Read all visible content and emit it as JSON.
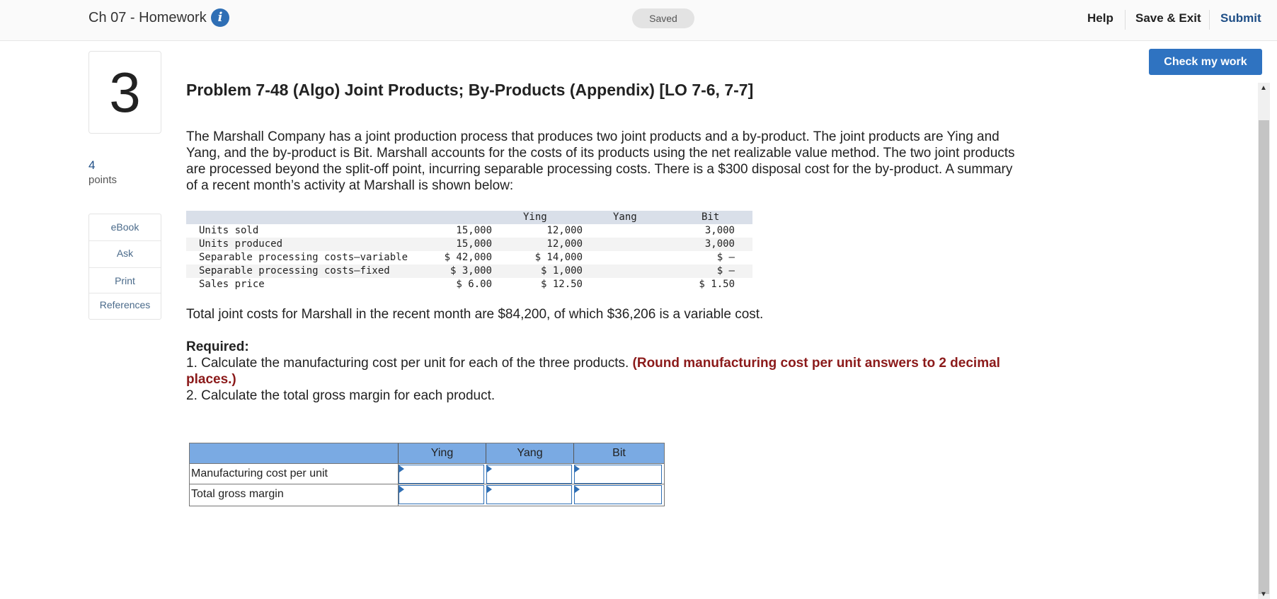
{
  "header": {
    "assignment_title": "Ch 07 - Homework",
    "info_icon": "i",
    "saved_label": "Saved",
    "nav": {
      "help": "Help",
      "save_exit": "Save & Exit",
      "submit": "Submit"
    }
  },
  "check_button": "Check my work",
  "question": {
    "number": "3",
    "points_value": "4",
    "points_label": "points",
    "tools": [
      "eBook",
      "Ask",
      "Print",
      "References"
    ]
  },
  "problem": {
    "title": "Problem 7-48 (Algo) Joint Products; By-Products (Appendix) [LO 7-6, 7-7]",
    "intro": "The Marshall Company has a joint production process that produces two joint products and a by-product. The joint products are Ying and Yang, and the by-product is Bit. Marshall accounts for the costs of its products using the net realizable value method. The two joint products are processed beyond the split-off point, incurring separable processing costs. There is a $300 disposal cost for the by-product. A summary of a recent month’s activity at Marshall is shown below:",
    "data_table": {
      "headers": [
        "Ying",
        "Yang",
        "Bit"
      ],
      "rows": [
        {
          "label": "Units sold",
          "values": [
            "15,000",
            "12,000",
            "3,000"
          ]
        },
        {
          "label": "Units produced",
          "values": [
            "15,000",
            "12,000",
            "3,000"
          ]
        },
        {
          "label": "Separable processing costs—variable",
          "values": [
            "$ 42,000",
            "$ 14,000",
            "$ –"
          ]
        },
        {
          "label": "Separable processing costs—fixed",
          "values": [
            "$ 3,000",
            "$ 1,000",
            "$ –"
          ]
        },
        {
          "label": "Sales price",
          "values": [
            "$ 6.00",
            "$ 12.50",
            "$ 1.50"
          ]
        }
      ]
    },
    "joint_costs": "Total joint costs for Marshall in the recent month are $84,200, of which $36,206 is a variable cost.",
    "required_heading": "Required:",
    "req1_text": "1. Calculate the manufacturing cost per unit for each of the three products. ",
    "req1_bold": "(Round manufacturing cost per unit answers to 2 decimal places.)",
    "req2_text": "2. Calculate the total gross margin for each product."
  },
  "answer_grid": {
    "columns": [
      "Ying",
      "Yang",
      "Bit"
    ],
    "rows": [
      "Manufacturing cost per unit",
      "Total gross margin"
    ],
    "inputs": [
      [
        "",
        "",
        ""
      ],
      [
        "",
        "",
        ""
      ]
    ]
  },
  "colors": {
    "accent": "#2f73c1",
    "grid_header": "#7aaae3",
    "required_bold": "#8b1a1a",
    "table_header": "#d9dfe9"
  }
}
